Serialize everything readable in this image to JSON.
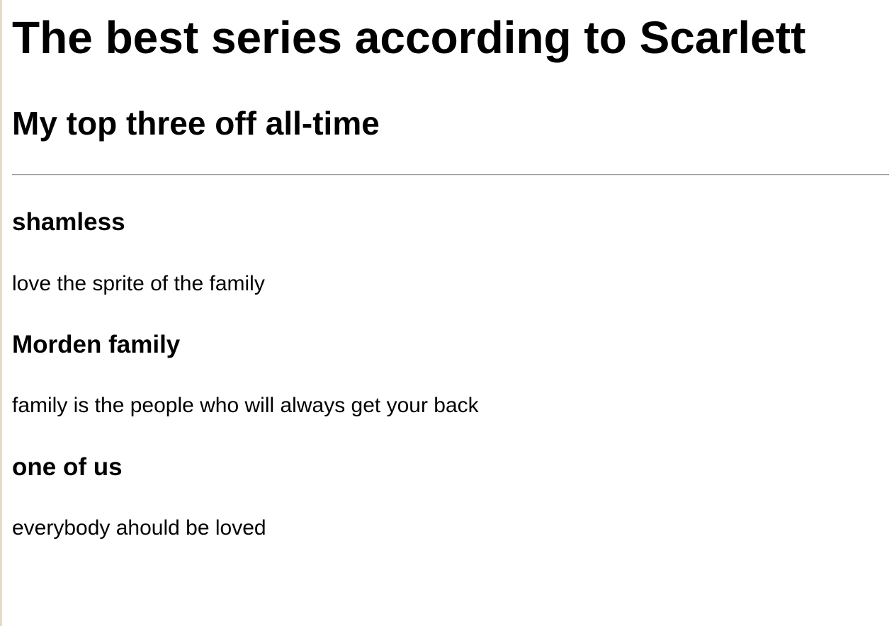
{
  "page": {
    "title": "The best series according to Scarlett",
    "subtitle": "My top three off all-time"
  },
  "series": [
    {
      "name": "shamless",
      "description": "love the sprite of the family"
    },
    {
      "name": "Morden family",
      "description": "family is the people who will always get your back"
    },
    {
      "name": "one of us",
      "description": "everybody ahould be loved"
    }
  ]
}
